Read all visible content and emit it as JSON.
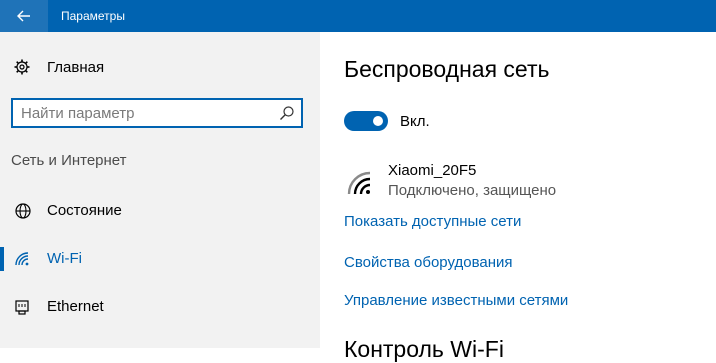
{
  "window": {
    "title": "Параметры"
  },
  "sidebar": {
    "home_label": "Главная",
    "search_placeholder": "Найти параметр",
    "section_header": "Сеть и Интернет",
    "items": [
      {
        "label": "Состояние",
        "icon": "globe-icon",
        "active": false
      },
      {
        "label": "Wi-Fi",
        "icon": "wifi-icon",
        "active": true
      },
      {
        "label": "Ethernet",
        "icon": "ethernet-icon",
        "active": false
      }
    ]
  },
  "main": {
    "title": "Беспроводная сеть",
    "toggle_state": "on",
    "toggle_label": "Вкл.",
    "network": {
      "ssid": "Xiaomi_20F5",
      "status": "Подключено, защищено",
      "icon": "wifi-signal-icon"
    },
    "links": [
      "Показать доступные сети",
      "Свойства оборудования",
      "Управление известными сетями"
    ],
    "next_section_title": "Контроль Wi-Fi"
  },
  "colors": {
    "accent": "#0063b1",
    "titlebar": "#0063b1",
    "sidebar_bg": "#f2f2f2"
  }
}
